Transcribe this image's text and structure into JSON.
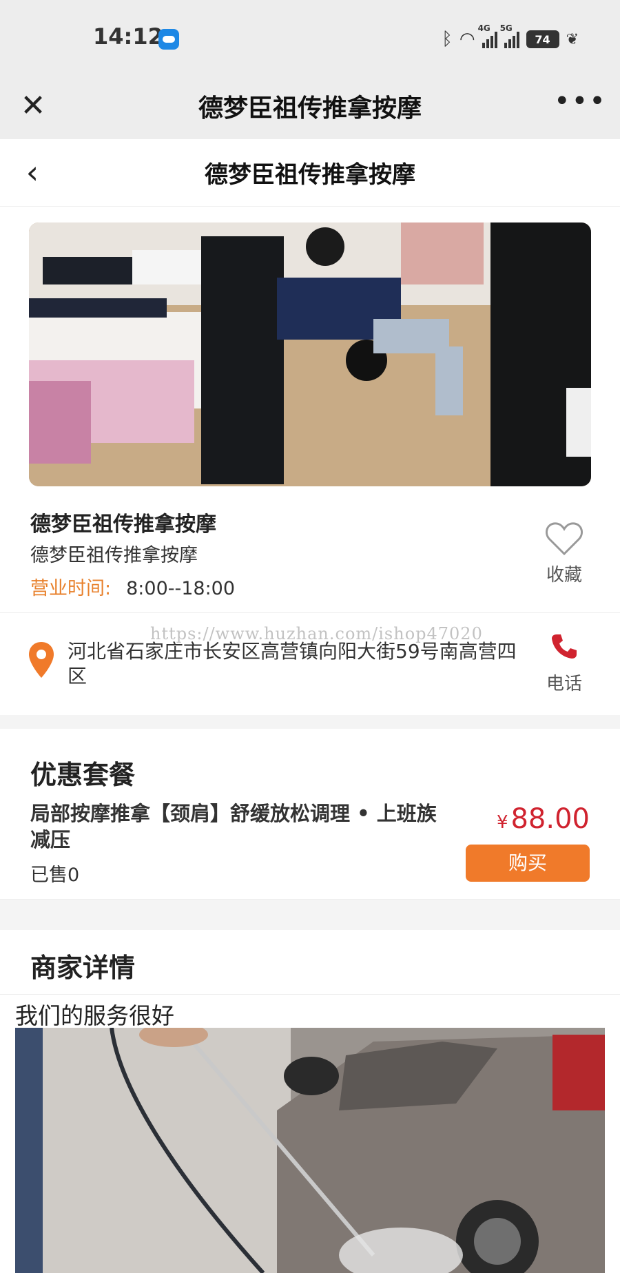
{
  "status_bar": {
    "time": "14:12",
    "network_1": "4G",
    "network_2": "5G",
    "battery": "74"
  },
  "title_bar": {
    "title": "德梦臣祖传推拿按摩",
    "close_icon": "close-icon",
    "more_icon": "more-icon"
  },
  "nav": {
    "title": "德梦臣祖传推拿按摩",
    "back_icon": "chevron-left-icon"
  },
  "shop": {
    "name": "德梦臣祖传推拿按摩",
    "subtitle": "德梦臣祖传推拿按摩",
    "hours_label": "营业时间:",
    "hours_value": "8:00--18:00",
    "favorite_label": "收藏"
  },
  "address": {
    "text": "河北省石家庄市长安区高营镇向阳大街59号南高营四区",
    "phone_label": "电话",
    "watermark": "https://www.huzhan.com/ishop47020"
  },
  "package": {
    "section_title": "优惠套餐",
    "name": "局部按摩推拿【颈肩】舒缓放松调理 • 上班族减压",
    "sold": "已售0",
    "currency": "¥",
    "price": "88.00",
    "buy_label": "购买"
  },
  "details": {
    "section_title": "商家详情",
    "text": "我们的服务很好"
  },
  "colors": {
    "accent_orange": "#f07a2a",
    "price_red": "#d0232f",
    "hours_orange": "#e8812c",
    "status_bg": "#ededed"
  }
}
